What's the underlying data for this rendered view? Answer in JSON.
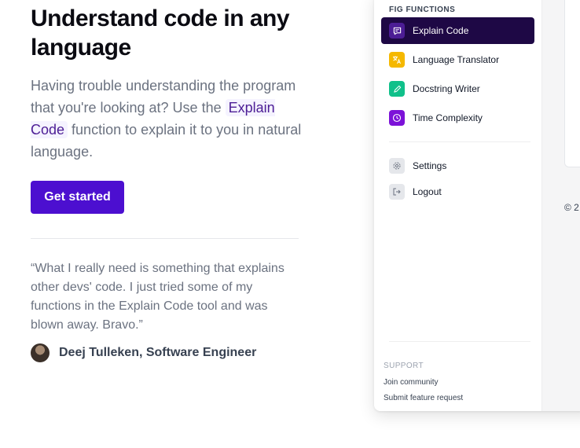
{
  "hero": {
    "title": "Understand code in any language",
    "desc_before": "Having trouble understanding the program that you're looking at? Use the",
    "desc_chip": "Explain Code",
    "desc_after": "function to explain it to you in natural language.",
    "cta_label": "Get started"
  },
  "testimonial": {
    "quote": "“What I really need is something that explains other devs' code. I just tried some of my functions in the Explain Code tool and was blown away. Bravo.”",
    "author": "Deej Tulleken, Software Engineer"
  },
  "app": {
    "section_label": "FIG FUNCTIONS",
    "functions": [
      {
        "label": "Explain Code",
        "icon": "message-square-icon",
        "color": "#4c1d95",
        "active": true
      },
      {
        "label": "Language Translator",
        "icon": "translate-icon",
        "color": "#f5b800",
        "active": false
      },
      {
        "label": "Docstring Writer",
        "icon": "pencil-icon",
        "color": "#10c08a",
        "active": false
      },
      {
        "label": "Time Complexity",
        "icon": "clock-icon",
        "color": "#7c12d8",
        "active": false
      }
    ],
    "utility": [
      {
        "label": "Settings",
        "icon": "gear-icon"
      },
      {
        "label": "Logout",
        "icon": "logout-icon"
      }
    ],
    "support_label": "SUPPORT",
    "support_links": [
      "Join community",
      "Submit feature request"
    ],
    "footer_text": "© 2"
  }
}
